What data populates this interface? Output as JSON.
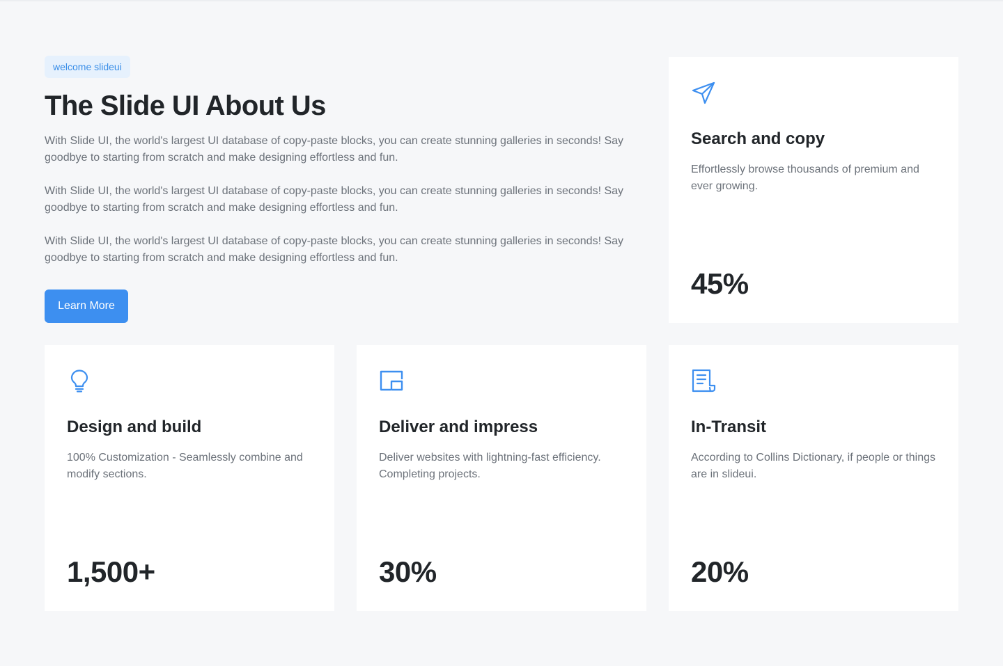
{
  "intro": {
    "tag": "welcome slideui",
    "heading": "The Slide UI About Us",
    "paragraphs": [
      "With Slide UI, the world's largest UI database of copy-paste blocks, you can create stunning galleries in seconds! Say goodbye to starting from scratch and make designing effortless and fun.",
      "With Slide UI, the world's largest UI database of copy-paste blocks, you can create stunning galleries in seconds! Say goodbye to starting from scratch and make designing effortless and fun.",
      "With Slide UI, the world's largest UI database of copy-paste blocks, you can create stunning galleries in seconds! Say goodbye to starting from scratch and make designing effortless and fun."
    ],
    "button_label": "Learn More"
  },
  "cards": [
    {
      "icon": "send-icon",
      "title": "Search and copy",
      "description": "Effortlessly browse thousands of premium and ever growing.",
      "stat": "45%"
    },
    {
      "icon": "lightbulb-icon",
      "title": "Design and build",
      "description": "100% Customization - Seamlessly combine and modify sections.",
      "stat": "1,500+"
    },
    {
      "icon": "picture-in-picture-icon",
      "title": "Deliver and impress",
      "description": "Deliver websites with lightning-fast efficiency. Completing projects.",
      "stat": "30%"
    },
    {
      "icon": "document-icon",
      "title": "In-Transit",
      "description": "According to Collins Dictionary, if people or things are in slideui.",
      "stat": "20%"
    }
  ],
  "colors": {
    "accent": "#3d8ff0",
    "tag_bg": "#e6f1fd",
    "page_bg": "#f6f7f9",
    "card_bg": "#ffffff",
    "heading": "#212529",
    "body_text": "#6c727a"
  }
}
